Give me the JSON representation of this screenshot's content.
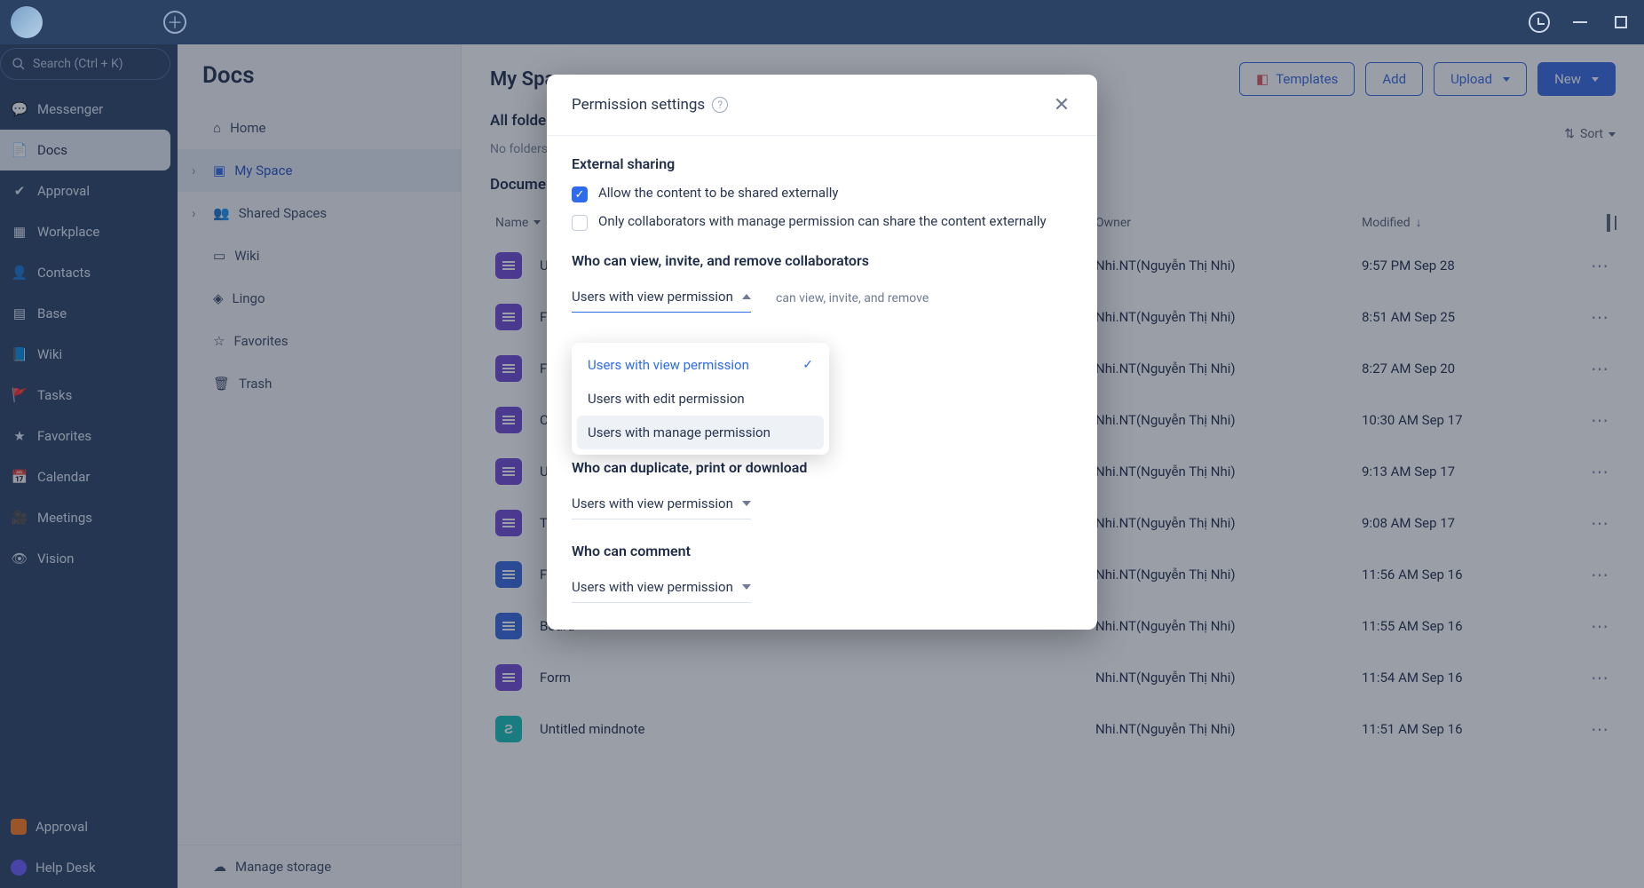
{
  "titlebar": {},
  "search": {
    "placeholder": "Search (Ctrl + K)"
  },
  "sidebar": {
    "items": [
      {
        "label": "Messenger"
      },
      {
        "label": "Docs"
      },
      {
        "label": "Approval"
      },
      {
        "label": "Workplace"
      },
      {
        "label": "Contacts"
      },
      {
        "label": "Base"
      },
      {
        "label": "Wiki"
      },
      {
        "label": "Tasks"
      },
      {
        "label": "Favorites"
      },
      {
        "label": "Calendar"
      },
      {
        "label": "Meetings"
      },
      {
        "label": "Vision"
      }
    ],
    "bottom": [
      {
        "label": "Approval"
      },
      {
        "label": "Help Desk"
      }
    ]
  },
  "tree": {
    "title": "Docs",
    "items": [
      {
        "label": "Home"
      },
      {
        "label": "My Space"
      },
      {
        "label": "Shared Spaces"
      },
      {
        "label": "Wiki"
      },
      {
        "label": "Lingo"
      },
      {
        "label": "Favorites"
      },
      {
        "label": "Trash"
      }
    ],
    "footer": {
      "label": "Manage storage"
    }
  },
  "main": {
    "title": "My Space",
    "buttons": {
      "templates": "Templates",
      "add": "Add",
      "upload": "Upload",
      "new": "New"
    },
    "allFolders": "All folders",
    "noFolders": "No folders yet.",
    "sort": "Sort",
    "docsHeading": "Documents",
    "cols": {
      "name": "Name",
      "owner": "Owner",
      "modified": "Modified"
    },
    "rows": [
      {
        "name": "Untitled base",
        "owner": "Nhi.NT(Nguyễn Thị Nhi)",
        "modified": "9:57 PM Sep 28",
        "ic": "base"
      },
      {
        "name": "Form",
        "owner": "Nhi.NT(Nguyễn Thị Nhi)",
        "modified": "8:51 AM Sep 25",
        "ic": "base"
      },
      {
        "name": "Form",
        "owner": "Nhi.NT(Nguyễn Thị Nhi)",
        "modified": "8:27 AM Sep 20",
        "ic": "base"
      },
      {
        "name": "Check-in Statis",
        "owner": "Nhi.NT(Nguyễn Thị Nhi)",
        "modified": "10:30 AM Sep 17",
        "ic": "base"
      },
      {
        "name": "Untitled base",
        "owner": "Nhi.NT(Nguyễn Thị Nhi)",
        "modified": "9:13 AM Sep 17",
        "ic": "base"
      },
      {
        "name": "Templates_Quả",
        "owner": "Nhi.NT(Nguyễn Thị Nhi)",
        "modified": "9:08 AM Sep 17",
        "ic": "base"
      },
      {
        "name": "Flowchart",
        "owner": "Nhi.NT(Nguyễn Thị Nhi)",
        "modified": "11:56 AM Sep 16",
        "ic": "doc"
      },
      {
        "name": "Board",
        "owner": "Nhi.NT(Nguyễn Thị Nhi)",
        "modified": "11:55 AM Sep 16",
        "ic": "doc"
      },
      {
        "name": "Form",
        "owner": "Nhi.NT(Nguyễn Thị Nhi)",
        "modified": "11:54 AM Sep 16",
        "ic": "base"
      },
      {
        "name": "Untitled mindnote",
        "owner": "Nhi.NT(Nguyễn Thị Nhi)",
        "modified": "11:51 AM Sep 16",
        "ic": "mind"
      }
    ]
  },
  "modal": {
    "title": "Permission settings",
    "sections": {
      "external": {
        "title": "External sharing",
        "opt1": "Allow the content to be shared externally",
        "opt2": "Only collaborators with manage permission can share the content externally"
      },
      "collab": {
        "title": "Who can view, invite, and remove collaborators",
        "value": "Users with view permission",
        "helper": "can view, invite, and remove"
      },
      "collab2": {
        "value": "Users with view permission"
      },
      "duplicate": {
        "title": "Who can duplicate, print or download",
        "value": "Users with view permission"
      },
      "comment": {
        "title": "Who can comment",
        "value": "Users with view permission"
      }
    },
    "dropdown": {
      "options": [
        "Users with view permission",
        "Users with edit permission",
        "Users with manage permission"
      ]
    }
  }
}
